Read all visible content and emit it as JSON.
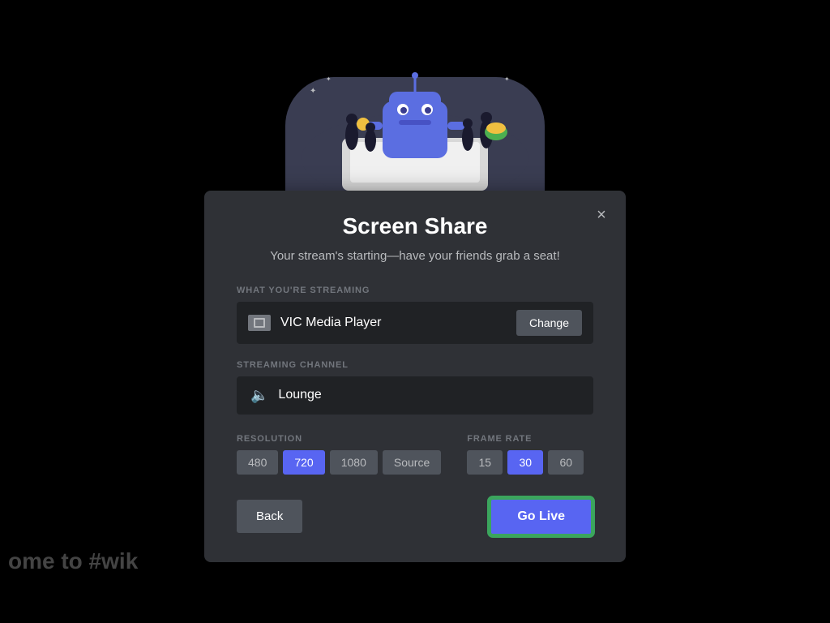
{
  "background": {
    "text": "ome to #wik"
  },
  "modal": {
    "title": "Screen Share",
    "subtitle": "Your stream's starting—have your friends\ngrab a seat!",
    "close_label": "×",
    "streaming_section": {
      "label": "WHAT YOU'RE STREAMING",
      "source_name": "VIC Media Player",
      "change_button": "Change"
    },
    "channel_section": {
      "label": "STREAMING CHANNEL",
      "channel_name": "Lounge"
    },
    "resolution_section": {
      "label": "RESOLUTION",
      "options": [
        "480",
        "720",
        "1080",
        "Source"
      ],
      "active": "720"
    },
    "framerate_section": {
      "label": "FRAME RATE",
      "options": [
        "15",
        "30",
        "60"
      ],
      "active": "30"
    },
    "back_button": "Back",
    "go_live_button": "Go Live"
  }
}
